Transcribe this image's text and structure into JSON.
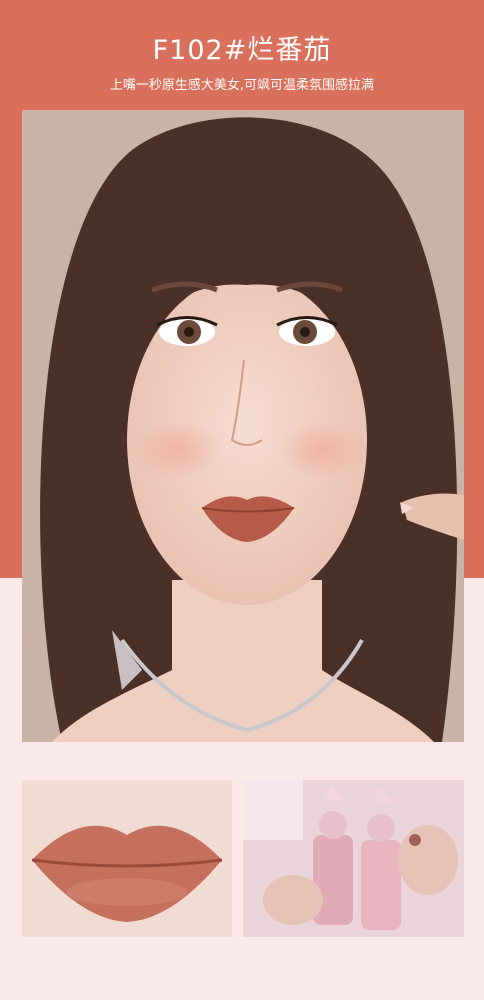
{
  "header": {
    "shade_title": "F102#烂番茄",
    "description": "上嘴一秒原生感大美女,可飒可温柔氛围感拉满"
  },
  "colors": {
    "band": "#d9705c",
    "page_background": "#fbe9ea",
    "lip_shade": "#b65a49"
  },
  "images": {
    "main": "model-face-photo",
    "lips_closeup": "lip-swatch-photo",
    "product": "lipstick-product-photo"
  }
}
